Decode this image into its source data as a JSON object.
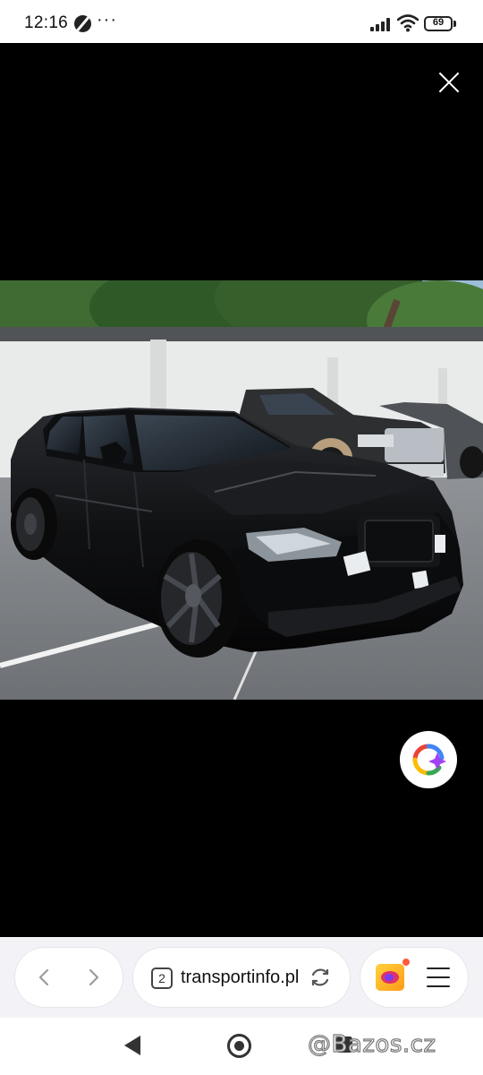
{
  "status_bar": {
    "time": "12:16",
    "more": "···",
    "battery_level": "69",
    "icons": [
      "app-notification-icon",
      "signal-icon",
      "wifi-icon",
      "battery-icon"
    ]
  },
  "viewer": {
    "close_icon": "close-icon",
    "photo_subject": "image",
    "lens_icon": "google-lens-icon"
  },
  "browser_bar": {
    "tab_count": "2",
    "url": "transportinfo.pl",
    "icons": [
      "back-arrow-icon",
      "forward-arrow-icon",
      "reload-icon",
      "profile-avatar-icon",
      "hamburger-menu-icon"
    ]
  },
  "system_nav": {
    "watermark": "@Bazos.cz"
  },
  "colors": {
    "viewer_bg": "#000000",
    "bar_bg": "#f3f3f7",
    "lens_blue": "#4285f4",
    "lens_red": "#ea4335",
    "lens_yellow": "#fbbc04",
    "lens_green": "#34a853"
  }
}
